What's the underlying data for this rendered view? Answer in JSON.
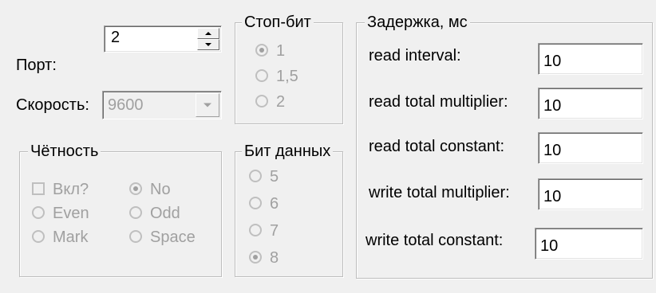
{
  "port": {
    "label": "Порт:",
    "value": "2"
  },
  "speed": {
    "label": "Скорость:",
    "value": "9600"
  },
  "parity": {
    "title": "Чётность",
    "enable_label": "Вкл?",
    "options": [
      "No",
      "Even",
      "Odd",
      "Mark",
      "Space"
    ],
    "selected": "No"
  },
  "stop_bits": {
    "title": "Стоп-бит",
    "options": [
      "1",
      "1,5",
      "2"
    ],
    "selected": "1"
  },
  "data_bits": {
    "title": "Бит данных",
    "options": [
      "5",
      "6",
      "7",
      "8"
    ],
    "selected": "8"
  },
  "delay": {
    "title": "Задержка, мс",
    "fields": [
      {
        "label": "read interval:",
        "value": "10"
      },
      {
        "label": "read total multiplier:",
        "value": "10"
      },
      {
        "label": "read total constant:",
        "value": "10"
      },
      {
        "label": "write total multiplier:",
        "value": "10"
      },
      {
        "label": "write total constant:",
        "value": "10"
      }
    ]
  }
}
